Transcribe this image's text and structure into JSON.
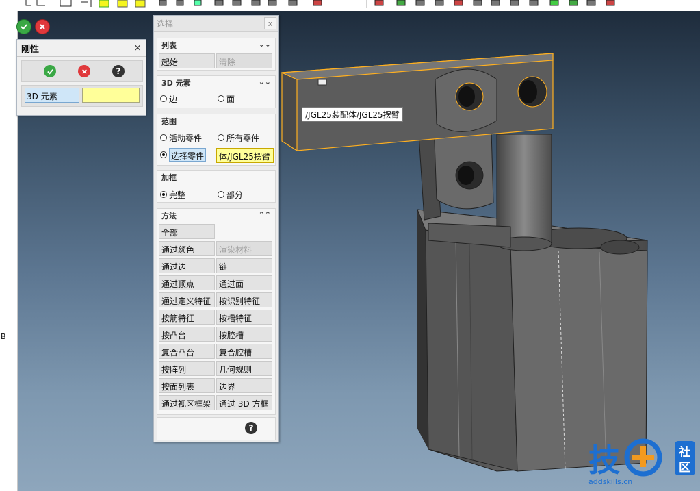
{
  "top_buttons": {
    "ok_icon": "check-icon",
    "cancel_icon": "close-icon"
  },
  "rigidity_panel": {
    "title": "刚性",
    "close_symbol": "×",
    "element_type_label": "3D 元素",
    "element_value": ""
  },
  "select_panel": {
    "title": "选择",
    "close_symbol": "x",
    "list_group": {
      "header": "列表",
      "start": "起始",
      "clear": "清除"
    },
    "element_group": {
      "header": "3D 元素",
      "edge": "边",
      "face": "面",
      "selected": "none"
    },
    "scope_group": {
      "header": "范围",
      "active_part": "活动零件",
      "all_parts": "所有零件",
      "selected_part": "选择零件",
      "part_value": "体/JGL25摆臂",
      "selected": "selected_part"
    },
    "frame_group": {
      "header": "加框",
      "full": "完整",
      "partial": "部分",
      "selected": "full"
    },
    "method_group": {
      "header": "方法",
      "buttons": [
        [
          "全部",
          ""
        ],
        [
          "通过颜色",
          "渲染材料"
        ],
        [
          "通过边",
          "链"
        ],
        [
          "通过顶点",
          "通过面"
        ],
        [
          "通过定义特征",
          "按识别特征"
        ],
        [
          "按筋特征",
          "按槽特征"
        ],
        [
          "按凸台",
          "按腔槽"
        ],
        [
          "复合凸台",
          "复合腔槽"
        ],
        [
          "按阵列",
          "几何规则"
        ],
        [
          "按面列表",
          "边界"
        ],
        [
          "通过视区框架",
          "通过 3D 方框"
        ]
      ]
    },
    "help_symbol": "?"
  },
  "tooltip": "/JGL25装配体/JGL25摆臂",
  "left_strip_letter": "B",
  "logo": {
    "main": "技",
    "badge_top": "社",
    "badge_bottom": "区",
    "site": "addskills.cn"
  },
  "colors": {
    "highlight": "#ffb020",
    "model": "#5f5f5f"
  }
}
